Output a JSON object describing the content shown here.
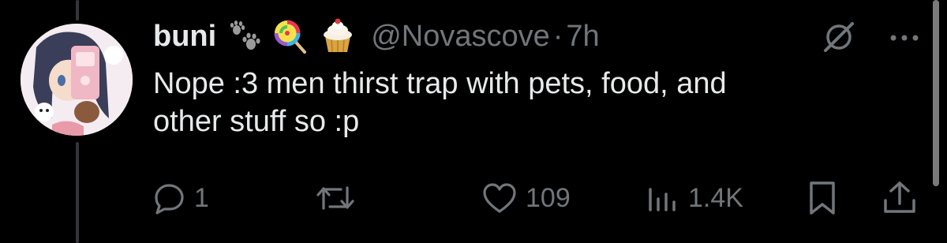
{
  "post": {
    "author": {
      "display_name": "buni",
      "handle": "@Novascove",
      "badges": [
        "paw-prints-emoji",
        "lollipop-emoji",
        "cupcake-emoji"
      ]
    },
    "separator": "·",
    "timestamp": "7h",
    "text_line1": "Nope :3 men thirst trap with pets, food, and",
    "text_line2": "other stuff so :p",
    "actions": {
      "reply_count": "1",
      "repost_count": "",
      "like_count": "109",
      "views_count": "1.4K"
    }
  },
  "colors": {
    "background": "#000000",
    "text_primary": "#e7e9ea",
    "text_secondary": "#71767b",
    "thread_line": "#333639"
  },
  "icons": {
    "header": [
      "grok-icon",
      "more-icon"
    ],
    "actions": [
      "reply-icon",
      "repost-icon",
      "like-icon",
      "views-icon",
      "bookmark-icon",
      "share-icon"
    ]
  }
}
